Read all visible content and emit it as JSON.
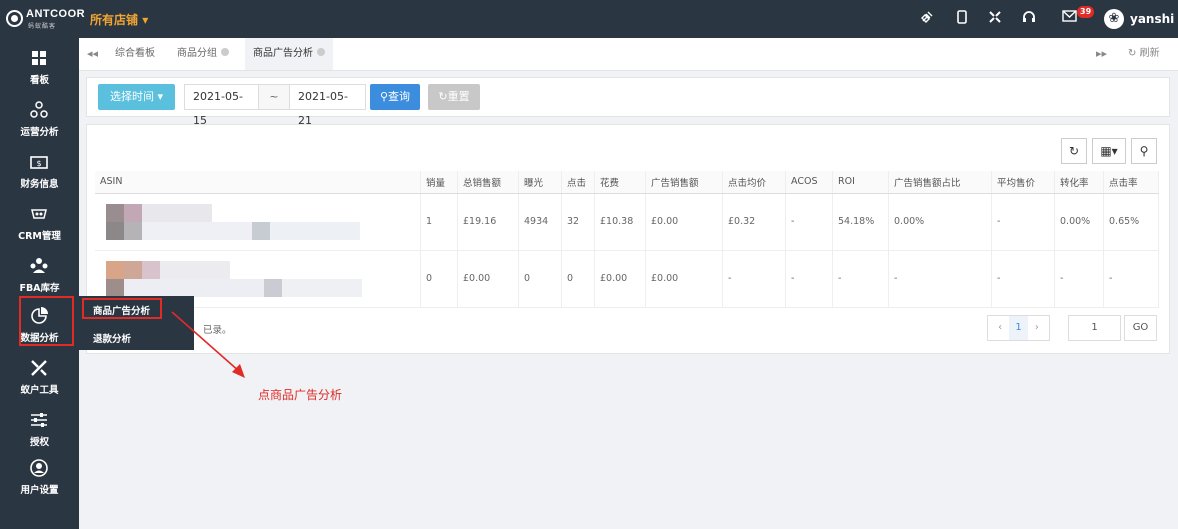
{
  "header": {
    "logo_text": "ANTCOOR",
    "logo_sub": "蚂蚁酷客",
    "store_selector": "所有店铺",
    "message_count": "39",
    "username": "yanshi",
    "icons": [
      "plug-icon",
      "tablet-icon",
      "fullscreen-icon",
      "headset-icon",
      "mail-icon"
    ]
  },
  "sidebar": {
    "items": [
      {
        "label": "看板",
        "icon": "dashboard-icon"
      },
      {
        "label": "运营分析",
        "icon": "molecule-icon"
      },
      {
        "label": "财务信息",
        "icon": "money-icon"
      },
      {
        "label": "CRM管理",
        "icon": "crm-icon"
      },
      {
        "label": "FBA库存",
        "icon": "boxes-icon"
      },
      {
        "label": "数据分析",
        "icon": "pie-chart-icon"
      },
      {
        "label": "蚁户工具",
        "icon": "tools-icon"
      },
      {
        "label": "授权",
        "icon": "sliders-icon"
      },
      {
        "label": "用户设置",
        "icon": "user-icon"
      }
    ],
    "submenu": [
      "商品广告分析",
      "退款分析"
    ]
  },
  "tabs": {
    "items": [
      "综合看板",
      "商品分组",
      "商品广告分析"
    ],
    "refresh": "刷新"
  },
  "filter": {
    "time_button": "选择时间",
    "start_date": "2021-05-15",
    "separator": "~",
    "end_date": "2021-05-21",
    "query": "查询",
    "reset": "重置"
  },
  "table": {
    "headers": [
      "ASIN",
      "销量",
      "总销售额",
      "曝光",
      "点击",
      "花费",
      "广告销售额",
      "点击均价",
      "ACOS",
      "ROI",
      "广告销售额占比",
      "平均售价",
      "转化率",
      "点击率"
    ],
    "rows": [
      [
        "",
        "1",
        "£19.16",
        "4934",
        "32",
        "£10.38",
        "£0.00",
        "£0.32",
        "-",
        "54.18%",
        "0.00%",
        "-",
        "0.00%",
        "0.65%"
      ],
      [
        "",
        "0",
        "£0.00",
        "0",
        "0",
        "£0.00",
        "£0.00",
        "-",
        "-",
        "-",
        "-",
        "-",
        "-",
        "-"
      ]
    ],
    "footer_text": "已录。",
    "page_current": "1",
    "page_input": "1",
    "go": "GO"
  },
  "annotation": "点商品广告分析"
}
